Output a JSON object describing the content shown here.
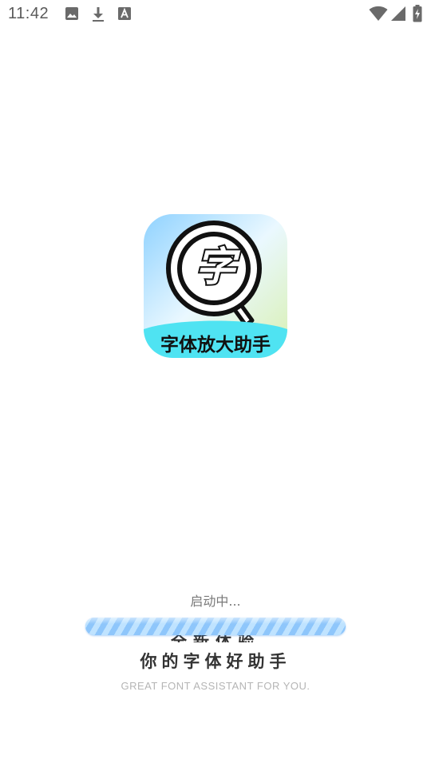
{
  "status_bar": {
    "time": "11:42",
    "notification_icons": [
      "image-icon",
      "download-icon",
      "font-icon"
    ],
    "system_icons": [
      "wifi-icon",
      "cell-signal-icon",
      "battery-charging-icon"
    ]
  },
  "app": {
    "icon_label": "字体放大助手",
    "icon_glyph": "字",
    "icon_colors": {
      "sky_blue": "#9fd8ff",
      "grass_green": "#d8f0b0",
      "banner_cyan": "#4fe3f2",
      "outline": "#111111"
    }
  },
  "loading": {
    "text": "启动中...",
    "progress": 1.0,
    "bar_color": "#9fd2ff"
  },
  "slogan": {
    "line1": "全新体验",
    "line2": "你的字体好助手",
    "english": "GREAT FONT ASSISTANT FOR YOU."
  }
}
